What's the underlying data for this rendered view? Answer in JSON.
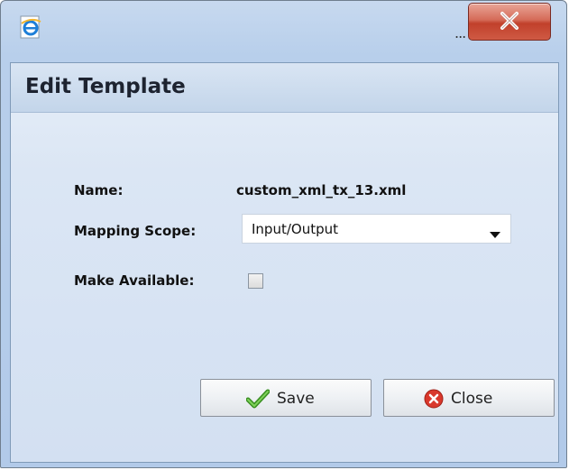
{
  "window": {
    "title_ellipsis": "...",
    "close_glyph": "X"
  },
  "dialog": {
    "title": "Edit Template",
    "fields": {
      "name_label": "Name:",
      "name_value": "custom_xml_tx_13.xml",
      "scope_label": "Mapping Scope:",
      "scope_value": "Input/Output",
      "available_label": "Make Available:",
      "available_checked": false
    },
    "buttons": {
      "save_label": "Save",
      "close_label": "Close"
    }
  },
  "icons": {
    "browser": "ie-logo-icon",
    "save": "checkmark-icon",
    "close": "close-circle-icon",
    "dropdown": "chevron-down-icon"
  },
  "colors": {
    "window_frame": "#b8cfeb",
    "close_button": "#c1402b",
    "panel_header": "#c3d5ea",
    "panel_body": "#dbe6f4",
    "save_check": "#4caf2c",
    "close_circle": "#d9382c"
  }
}
